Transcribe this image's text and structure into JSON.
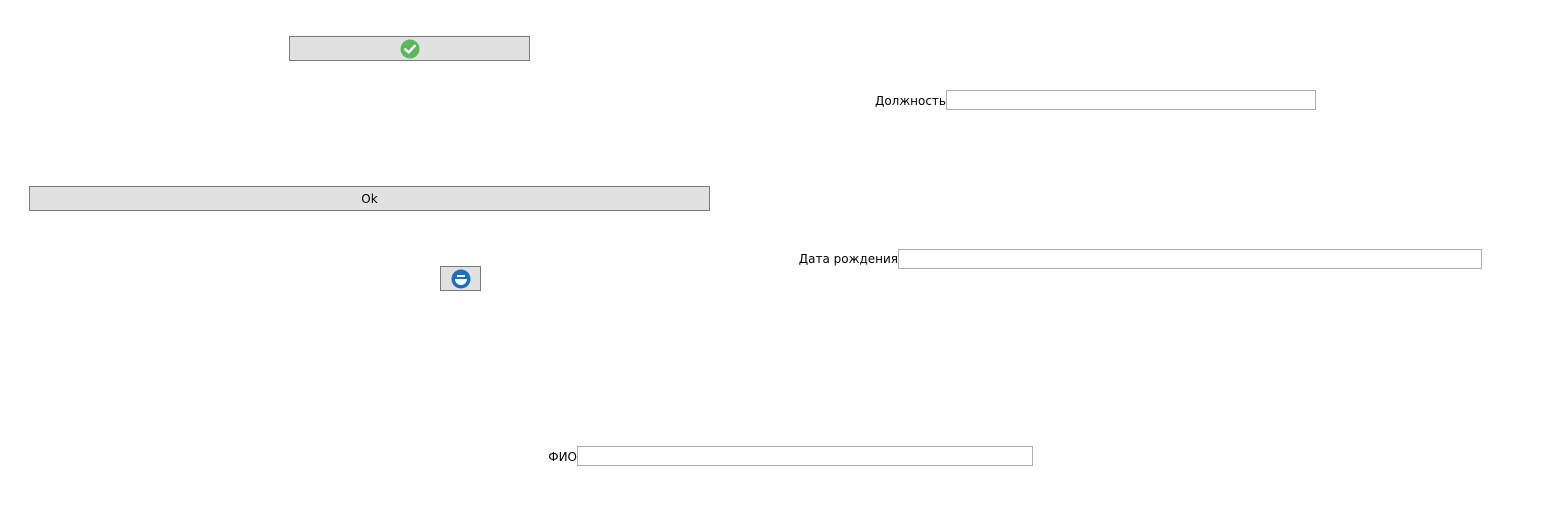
{
  "buttons": {
    "confirm_icon": "check-circle-icon",
    "ok_label": "Ok",
    "logo_icon": "blue-round-logo-icon"
  },
  "fields": {
    "position": {
      "label": "Должность",
      "value": ""
    },
    "birth_date": {
      "label": "Дата рождения",
      "value": ""
    },
    "full_name": {
      "label": "ФИО",
      "value": ""
    }
  },
  "colors": {
    "button_face": "#e1e1e1",
    "button_border": "#7a7a7a",
    "input_border": "#abadb3",
    "check_green": "#5cb85c",
    "logo_blue": "#1b6fc2"
  }
}
